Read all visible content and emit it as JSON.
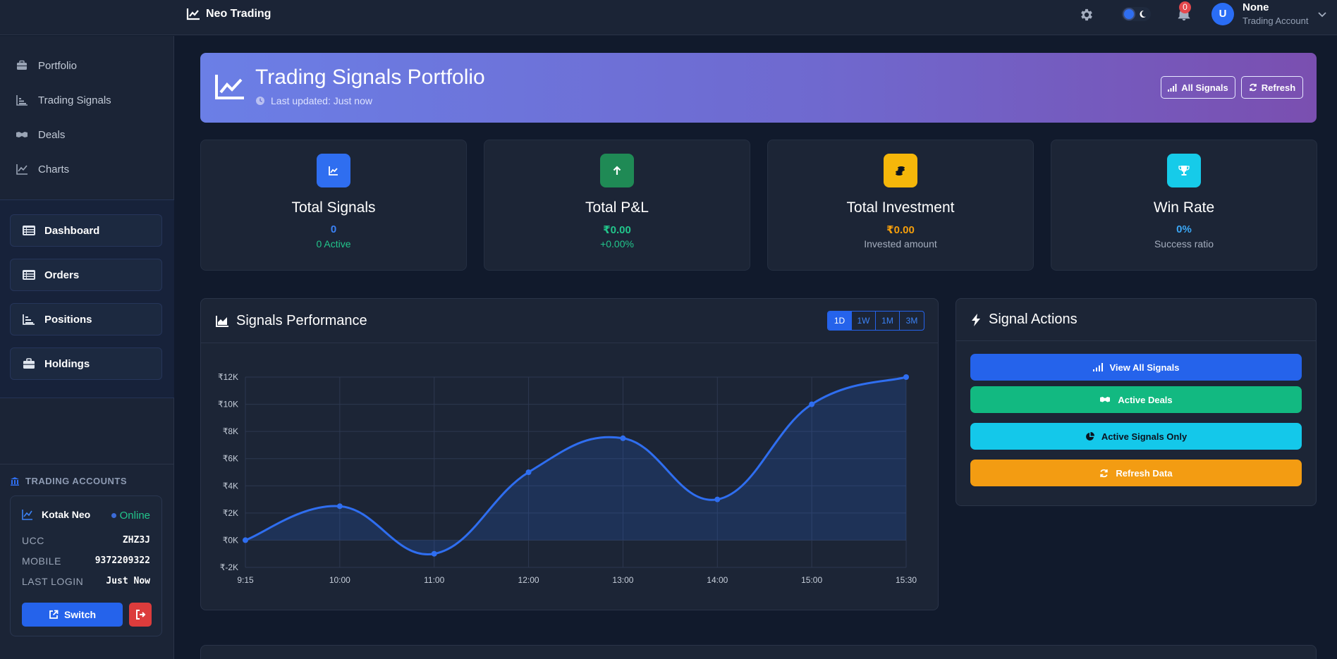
{
  "navbar": {
    "brand": "Neo Trading",
    "notification_count": "0",
    "avatar_initial": "U",
    "user_name": "None",
    "user_role": "Trading Account"
  },
  "sidebar": {
    "links": [
      {
        "label": "Portfolio",
        "icon": "briefcase-icon"
      },
      {
        "label": "Trading Signals",
        "icon": "bar-chart-icon"
      },
      {
        "label": "Deals",
        "icon": "handshake-icon"
      },
      {
        "label": "Charts",
        "icon": "line-chart-icon"
      }
    ],
    "buttons": [
      {
        "label": "Dashboard",
        "icon": "list-icon"
      },
      {
        "label": "Orders",
        "icon": "list-icon"
      },
      {
        "label": "Positions",
        "icon": "bar-chart-icon"
      },
      {
        "label": "Holdings",
        "icon": "briefcase-icon"
      }
    ],
    "accounts_title": "TRADING ACCOUNTS",
    "account": {
      "name": "Kotak Neo",
      "status": "Online",
      "rows": [
        {
          "key": "UCC",
          "value": "ZHZ3J"
        },
        {
          "key": "MOBILE",
          "value": "9372209322"
        },
        {
          "key": "LAST LOGIN",
          "value": "Just Now"
        }
      ],
      "switch_label": "Switch"
    }
  },
  "hero": {
    "title": "Trading Signals Portfolio",
    "subtitle": "Last updated: Just now",
    "all_signals_label": "All Signals",
    "refresh_label": "Refresh"
  },
  "stats": [
    {
      "title": "Total Signals",
      "value": "0",
      "sub": "0 Active",
      "color": "#2f6ef0",
      "value_color": "#3b82f6",
      "sub_color": "#22c58b"
    },
    {
      "title": "Total P&L",
      "value": "₹0.00",
      "sub": "+0.00%",
      "color": "#1f8a55",
      "value_color": "#22c58b",
      "sub_color": "#22c58b"
    },
    {
      "title": "Total Investment",
      "value": "₹0.00",
      "sub": "Invested amount",
      "color": "#f5b70a",
      "value_color": "#f59e0b",
      "sub_color": "#a4adbd"
    },
    {
      "title": "Win Rate",
      "value": "0%",
      "sub": "Success ratio",
      "color": "#16cbe9",
      "value_color": "#3ba7f5",
      "sub_color": "#a4adbd"
    }
  ],
  "performance": {
    "title": "Signals Performance",
    "ranges": [
      "1D",
      "1W",
      "1M",
      "3M"
    ],
    "active_range": "1D"
  },
  "chart_data": {
    "type": "area",
    "x": [
      "9:15",
      "10:00",
      "11:00",
      "12:00",
      "13:00",
      "14:00",
      "15:00",
      "15:30"
    ],
    "values": [
      0,
      2500,
      -1000,
      5000,
      7500,
      3000,
      10000,
      12000
    ],
    "yticks": [
      "₹12K",
      "₹10K",
      "₹8K",
      "₹6K",
      "₹4K",
      "₹2K",
      "₹0K",
      "₹-2K"
    ],
    "ylim": [
      -2000,
      12000
    ],
    "grid": true,
    "line_color": "#2f6ef0"
  },
  "actions": {
    "title": "Signal Actions",
    "buttons": [
      {
        "label": "View All Signals",
        "bg": "#2563eb",
        "fg": "#ffffff",
        "icon": "signal-icon"
      },
      {
        "label": "Active Deals",
        "bg": "#12b981",
        "fg": "#ffffff",
        "icon": "handshake-icon"
      },
      {
        "label": "Active Signals Only",
        "bg": "#14c8ea",
        "fg": "#0b1320",
        "icon": "pie-chart-icon"
      },
      {
        "label": "Refresh Data",
        "bg": "#f39c12",
        "fg": "#ffffff",
        "icon": "refresh-icon"
      }
    ]
  }
}
